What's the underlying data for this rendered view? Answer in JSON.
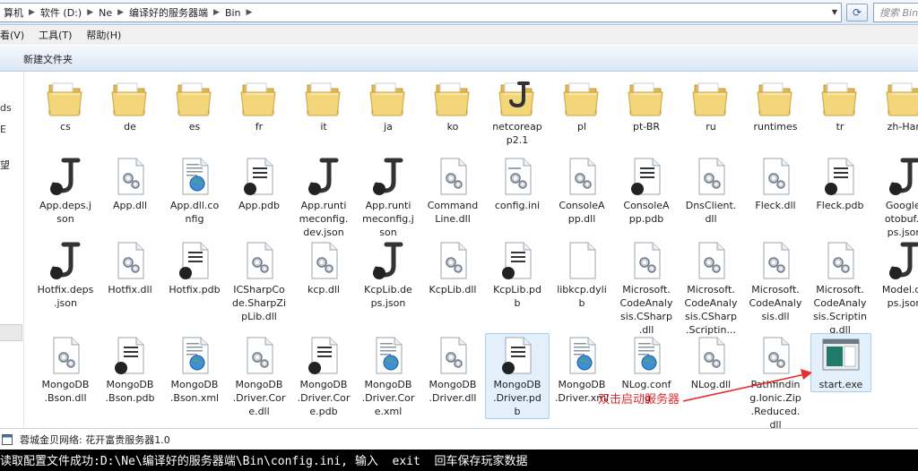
{
  "address": {
    "crumbs": [
      "算机",
      "软件 (D:)",
      "Ne",
      "编译好的服务器端",
      "Bin"
    ],
    "search_placeholder": "搜索 Bin"
  },
  "menu": [
    "看(V)",
    "工具(T)",
    "帮助(H)"
  ],
  "toolbar": {
    "new_folder": "新建文件夹"
  },
  "nav": {
    "items": [
      "ds",
      "E",
      "望"
    ]
  },
  "files": [
    {
      "name": "cs",
      "type": "folder"
    },
    {
      "name": "de",
      "type": "folder"
    },
    {
      "name": "es",
      "type": "folder"
    },
    {
      "name": "fr",
      "type": "folder"
    },
    {
      "name": "it",
      "type": "folder"
    },
    {
      "name": "ja",
      "type": "folder"
    },
    {
      "name": "ko",
      "type": "folder"
    },
    {
      "name": "netcoreap\np2.1",
      "type": "folderj"
    },
    {
      "name": "pl",
      "type": "folder"
    },
    {
      "name": "pt-BR",
      "type": "folder"
    },
    {
      "name": "ru",
      "type": "folder"
    },
    {
      "name": "runtimes",
      "type": "folder"
    },
    {
      "name": "tr",
      "type": "folder"
    },
    {
      "name": "zh-Han",
      "type": "folder"
    },
    {
      "name": "App.deps.j\nson",
      "type": "json"
    },
    {
      "name": "App.dll",
      "type": "dll"
    },
    {
      "name": "App.dll.co\nnfig",
      "type": "config"
    },
    {
      "name": "App.pdb",
      "type": "pdb"
    },
    {
      "name": "App.runti\nmeconfig.\ndev.json",
      "type": "json"
    },
    {
      "name": "App.runti\nmeconfig.j\nson",
      "type": "json"
    },
    {
      "name": "Command\nLine.dll",
      "type": "dll"
    },
    {
      "name": "config.ini",
      "type": "ini"
    },
    {
      "name": "ConsoleA\npp.dll",
      "type": "dll"
    },
    {
      "name": "ConsoleA\npp.pdb",
      "type": "pdb"
    },
    {
      "name": "DnsClient.\ndll",
      "type": "dll"
    },
    {
      "name": "Fleck.dll",
      "type": "dll"
    },
    {
      "name": "Fleck.pdb",
      "type": "pdb"
    },
    {
      "name": "Google.\notobuf.c\nps.json",
      "type": "json"
    },
    {
      "name": "Hotfix.deps\n.json",
      "type": "json"
    },
    {
      "name": "Hotfix.dll",
      "type": "dll"
    },
    {
      "name": "Hotfix.pdb",
      "type": "pdb"
    },
    {
      "name": "ICSharpCo\nde.SharpZi\npLib.dll",
      "type": "dll"
    },
    {
      "name": "kcp.dll",
      "type": "dll"
    },
    {
      "name": "KcpLib.de\nps.json",
      "type": "json"
    },
    {
      "name": "KcpLib.dll",
      "type": "dll"
    },
    {
      "name": "KcpLib.pd\nb",
      "type": "pdb"
    },
    {
      "name": "libkcp.dyli\nb",
      "type": "blank"
    },
    {
      "name": "Microsoft.\nCodeAnaly\nsis.CSharp\n.dll",
      "type": "dll"
    },
    {
      "name": "Microsoft.\nCodeAnaly\nsis.CSharp\n.Scriptin...",
      "type": "dll"
    },
    {
      "name": "Microsoft.\nCodeAnaly\nsis.dll",
      "type": "dll"
    },
    {
      "name": "Microsoft.\nCodeAnaly\nsis.Scriptin\ng.dll",
      "type": "dll"
    },
    {
      "name": "Model.de\nps.json",
      "type": "json"
    },
    {
      "name": "MongoDB\n.Bson.dll",
      "type": "dll"
    },
    {
      "name": "MongoDB\n.Bson.pdb",
      "type": "pdb"
    },
    {
      "name": "MongoDB\n.Bson.xml",
      "type": "xml"
    },
    {
      "name": "MongoDB\n.Driver.Cor\ne.dll",
      "type": "dll"
    },
    {
      "name": "MongoDB\n.Driver.Cor\ne.pdb",
      "type": "pdb"
    },
    {
      "name": "MongoDB\n.Driver.Cor\ne.xml",
      "type": "xml"
    },
    {
      "name": "MongoDB\n.Driver.dll",
      "type": "dll"
    },
    {
      "name": "MongoDB\n.Driver.pd\nb",
      "type": "pdb",
      "selected": true
    },
    {
      "name": "MongoDB\n.Driver.xml",
      "type": "xml"
    },
    {
      "name": "NLog.conf\nig",
      "type": "config"
    },
    {
      "name": "NLog.dll",
      "type": "dll"
    },
    {
      "name": "Pathfindin\ng.Ionic.Zip\n.Reduced.\ndll",
      "type": "dll"
    },
    {
      "name": "start.exe",
      "type": "exe",
      "selected": true
    }
  ],
  "annotation": {
    "text": "双击启动服务器"
  },
  "status": {
    "text": "蓉城金贝网络: 花开富贵服务器1.0"
  },
  "console": {
    "line1": "读取配置文件成功:D:\\Ne\\编译好的服务器端\\Bin\\config.ini, 输入  exit  回车保存玩家数据"
  },
  "colors": {
    "folder": "#f3d67a",
    "accent": "#2a5a9c",
    "annotation": "#e82c2c"
  }
}
